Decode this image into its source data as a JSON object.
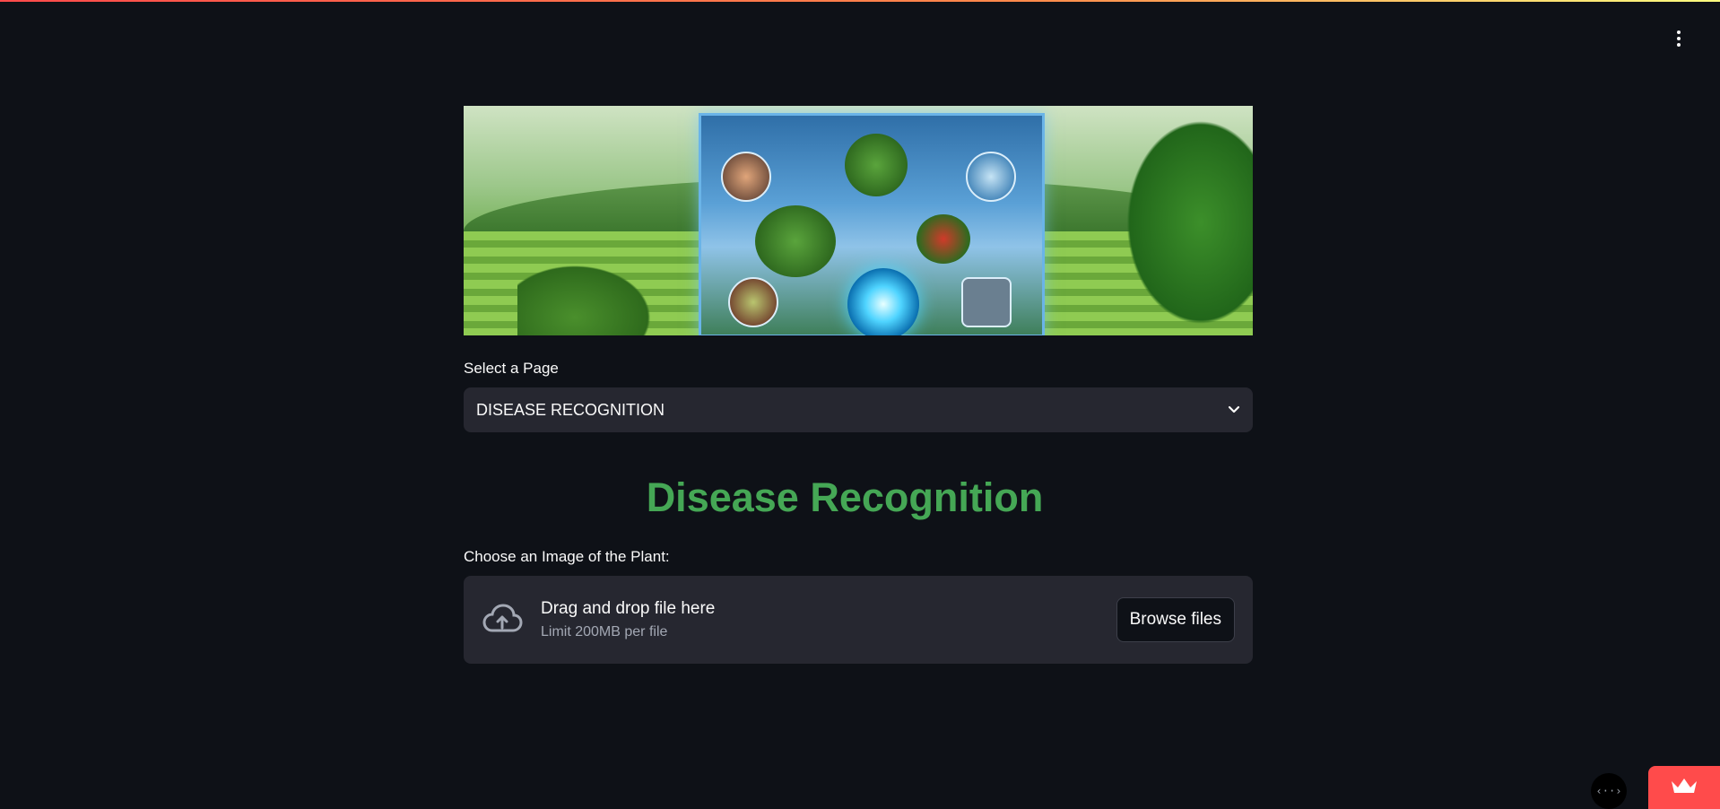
{
  "colors": {
    "background": "#0e1117",
    "accent_green": "#45a755",
    "widget_bg": "#262730",
    "streamlit_red": "#ff4b4b"
  },
  "header": {
    "menu_icon": "vertical-dots-icon"
  },
  "hero": {
    "image": "plant-ai-banner"
  },
  "page_select": {
    "label": "Select a Page",
    "value": "DISEASE RECOGNITION",
    "icon": "chevron-down-icon"
  },
  "main": {
    "title": "Disease Recognition"
  },
  "uploader": {
    "label": "Choose an Image of the Plant:",
    "icon": "cloud-upload-icon",
    "drop_title": "Drag and drop file here",
    "drop_sub": "Limit 200MB per file",
    "browse_label": "Browse files"
  },
  "footer": {
    "dev_toggle_text": "‹··›",
    "badge_icon": "crown-icon"
  }
}
